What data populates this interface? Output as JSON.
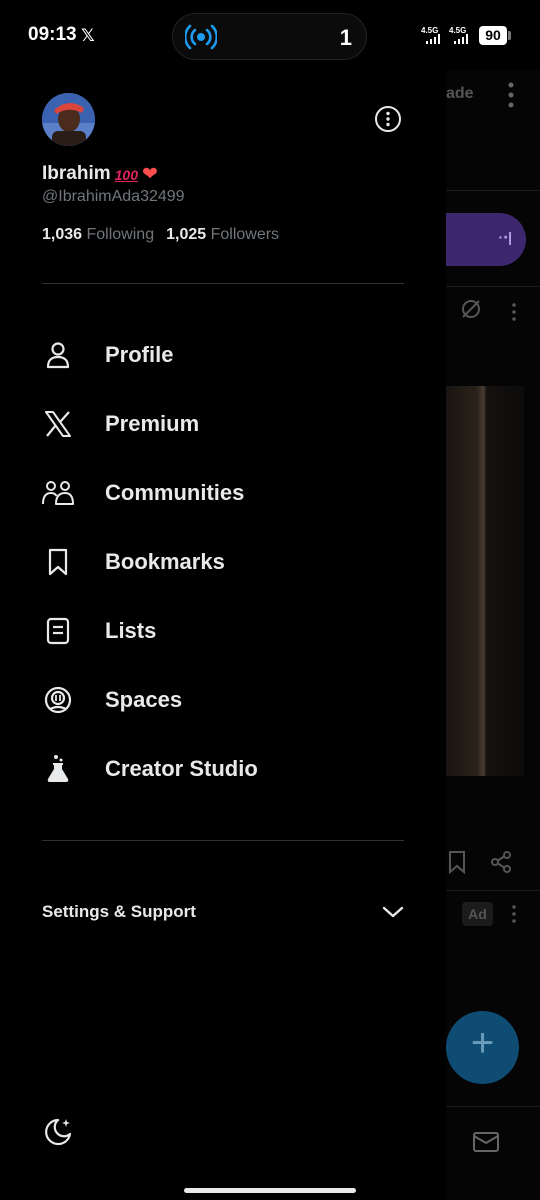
{
  "status_bar": {
    "time": "09:13",
    "app_glyph": "𝕏",
    "live_count": "1",
    "network_1": "4.5G",
    "network_2": "4.5G",
    "battery": "90"
  },
  "profile": {
    "name": "Ibrahim",
    "handle": "@IbrahimAda32499",
    "following_count": "1,036",
    "following_label": "Following",
    "followers_count": "1,025",
    "followers_label": "Followers"
  },
  "menu": [
    {
      "label": "Profile",
      "icon": "person-icon"
    },
    {
      "label": "Premium",
      "icon": "x-logo-icon"
    },
    {
      "label": "Communities",
      "icon": "communities-icon"
    },
    {
      "label": "Bookmarks",
      "icon": "bookmark-icon"
    },
    {
      "label": "Lists",
      "icon": "list-icon"
    },
    {
      "label": "Spaces",
      "icon": "spaces-icon"
    },
    {
      "label": "Creator Studio",
      "icon": "flask-icon"
    }
  ],
  "settings": {
    "label": "Settings & Support"
  },
  "background": {
    "header_fragment": "ade",
    "ad_badge": "Ad"
  },
  "colors": {
    "background": "#000000",
    "text_primary": "#e7e9ea",
    "text_secondary": "#71767b",
    "divider": "#2f3336",
    "live_blue": "#1d9bf0"
  }
}
